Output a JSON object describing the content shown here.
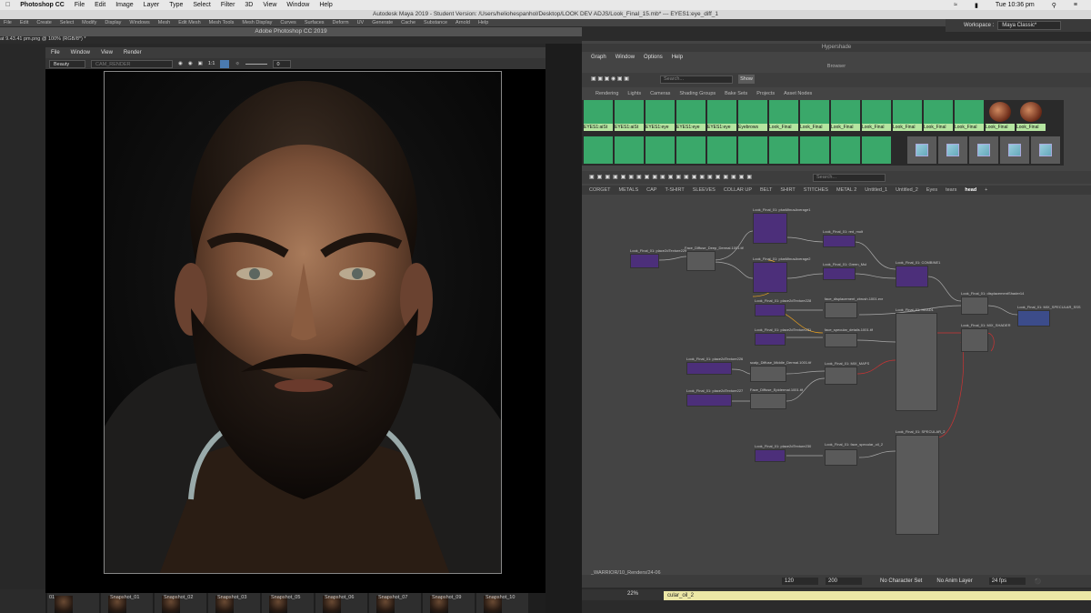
{
  "mac": {
    "apple": "",
    "menu": [
      "Photoshop CC",
      "File",
      "Edit",
      "Image",
      "Layer",
      "Type",
      "Select",
      "Filter",
      "3D",
      "View",
      "Window",
      "Help"
    ],
    "clock": "Tue 10:36 pm"
  },
  "maya": {
    "title": "Autodesk Maya 2019 - Student Version: /Users/heliohespanhol/Desktop/LOOK DEV ADJS/Look_Final_15.mb*  ---  EYES1:eye_diff_1",
    "menu": [
      "File",
      "Edit",
      "Create",
      "Select",
      "Modify",
      "Display",
      "Windows",
      "Mesh",
      "Edit Mesh",
      "Mesh Tools",
      "Mesh Display",
      "Curves",
      "Surfaces",
      "Deform",
      "UV",
      "Generate",
      "Cache",
      "Substance",
      "Arnold",
      "Help"
    ],
    "workspace_label": "Workspace :",
    "workspace_value": "Maya Classic*"
  },
  "photoshop": {
    "title": "Adobe Photoshop CC 2019",
    "doc_tab": "at 9.43.41 pm.png @ 100% (RGB/8*) *",
    "viewer_menu": [
      "File",
      "Window",
      "View",
      "Render"
    ],
    "aov": "Beauty",
    "camera": "CAM_RENDER",
    "ratio": "1:1",
    "exposure": "0",
    "snapshots": [
      "01",
      "Snapshot_01",
      "Snapshot_02",
      "Snapshot_03",
      "Snapshot_05",
      "Snapshot_06",
      "Snapshot_07",
      "Snapshot_09",
      "Snapshot_10"
    ]
  },
  "hypershade": {
    "title": "Hypershade",
    "menu": [
      "Graph",
      "Window",
      "Options",
      "Help"
    ],
    "browser_title": "Browser",
    "search_placeholder": "Search...",
    "show": "Show",
    "browser_tabs": [
      "Rendering",
      "Lights",
      "Cameras",
      "Shading Groups",
      "Bake Sets",
      "Projects",
      "Asset Nodes"
    ],
    "swatches": [
      "EYES1:aiSt",
      "EYES1:aiSt",
      "EYES1:eye",
      "EYES1:eye",
      "EYES1:eye",
      "Eyebrows",
      "Look_Final",
      "Look_Final",
      "Look_Final",
      "Look_Final",
      "Look_Final",
      "Look_Final",
      "Look_Final",
      "Look_Final",
      "Look_Final"
    ],
    "graph_search": "Search...",
    "graph_tabs": [
      "CORGET",
      "METALS",
      "CAP",
      "T-SHIRT",
      "SLEEVES",
      "COLLAR UP",
      "BELT",
      "SHIRT",
      "STITCHES",
      "METAL 2",
      "Untitled_1",
      "Untitled_2",
      "Eyes",
      "tears",
      "head",
      "+"
    ],
    "active_tab": "head",
    "nodes": {
      "n1": "Look_Final_01: plusMinusAverage1",
      "n2": "Look_Final_01: place2dTexture229",
      "n3": "Face_Diffuse_Deep_Dermal.1001.tif",
      "n4": "Look_Final_01: plusMinusAverage2",
      "n5": "Look_Final_01: red_mult",
      "n6": "Look_Final_01: Green_Mul",
      "n7": "Look_Final_01: COMBINE1",
      "n8": "Look_Final_01: place2dTexture228",
      "n9": "face_displacement_zbrush.1001.exr",
      "n10": "Look_Final_01: displacementShader14",
      "n11": "Look_Final_01: MIX_SPECULAR_SSS",
      "n12": "Look_Final_01: place2dTexture231",
      "n13": "face_specular_details.1001.tif",
      "n14": "Look_Final_01: HEAD1",
      "n15": "Look_Final_01: place2dTexture226",
      "n16": "scalp_Diffuse_Middle_Dermal.1001.tif",
      "n17": "Look_Final_01: MIX_MAPS",
      "n18": "Look_Final_01: place2dTexture227",
      "n19": "Face_Diffuse_Epidermal.1001.tif",
      "n20": "Look_Final_01: MIX_SHADER",
      "n21": "Look_Final_01: place2dTexture230",
      "n22": "Look_Final_01: face_specular_oil_2",
      "n23": "Look_Final_01: SPECULAR_2"
    }
  },
  "bottom": {
    "render_path": "_WARRIOR/10_Renders/24-06",
    "frame_a": "120",
    "frame_b": "200",
    "character_set": "No Character Set",
    "anim_layer": "No Anim Layer",
    "fps": "24 fps",
    "zoom": "22%",
    "status": "cular_oil_2"
  },
  "colors": {
    "node_purple": "#4c2f7a",
    "swatch_green": "#3aa86a",
    "status_yellow": "#ece7a6"
  }
}
